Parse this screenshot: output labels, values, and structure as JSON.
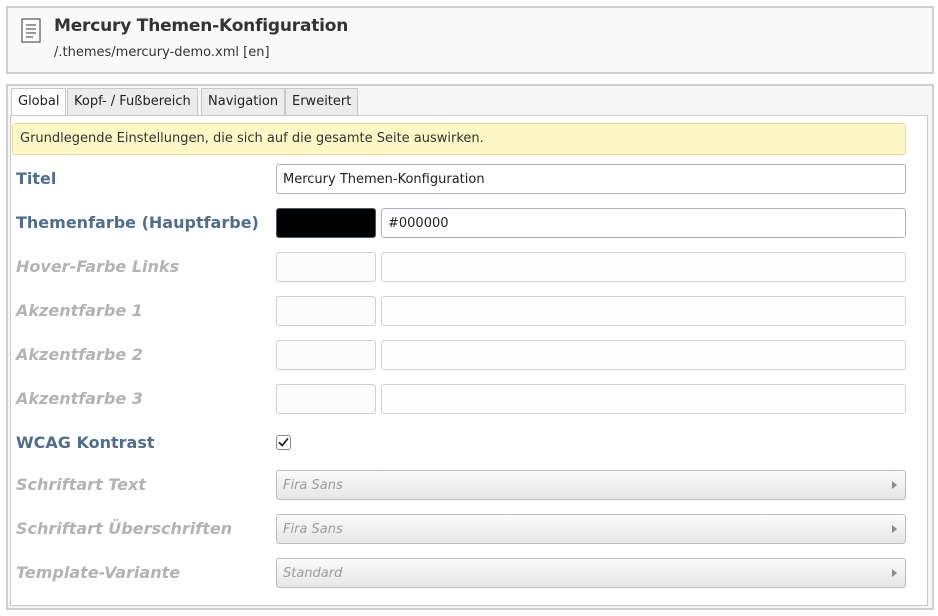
{
  "header": {
    "title": "Mercury Themen-Konfiguration",
    "path": "/.themes/mercury-demo.xml [en]",
    "icon": "document-icon"
  },
  "tabs": [
    {
      "label": "Global",
      "active": true
    },
    {
      "label": "Kopf- / Fußbereich",
      "active": false
    },
    {
      "label": "Navigation",
      "active": false
    },
    {
      "label": "Erweitert",
      "active": false
    }
  ],
  "info_text": "Grundlegende Einstellungen, die sich auf die gesamte Seite auswirken.",
  "fields": {
    "title": {
      "label": "Titel",
      "value": "Mercury Themen-Konfiguration"
    },
    "theme_color": {
      "label": "Themenfarbe (Hauptfarbe)",
      "value": "#000000",
      "swatch": "#000000"
    },
    "hover_color": {
      "label": "Hover-Farbe Links",
      "value": ""
    },
    "accent1": {
      "label": "Akzentfarbe 1",
      "value": ""
    },
    "accent2": {
      "label": "Akzentfarbe 2",
      "value": ""
    },
    "accent3": {
      "label": "Akzentfarbe 3",
      "value": ""
    },
    "wcag": {
      "label": "WCAG Kontrast",
      "checked": true
    },
    "font_text": {
      "label": "Schriftart Text",
      "value": "Fira Sans"
    },
    "font_headings": {
      "label": "Schriftart Überschriften",
      "value": "Fira Sans"
    },
    "template_variant": {
      "label": "Template-Variante",
      "value": "Standard"
    }
  },
  "colors": {
    "label_active": "#4f6e8d",
    "label_disabled": "#b3b3b3",
    "info_bg": "#fdf8c6"
  }
}
